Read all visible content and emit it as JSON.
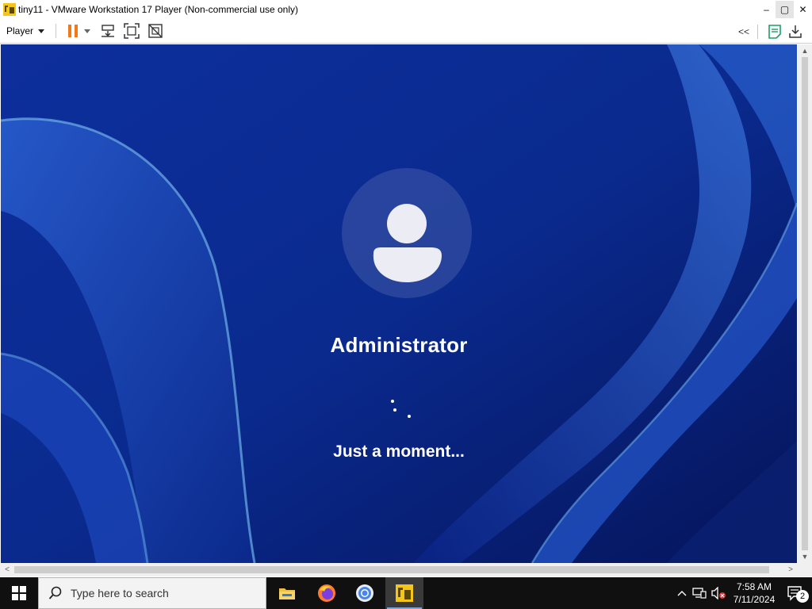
{
  "window": {
    "title": "tiny11 - VMware Workstation 17 Player (Non-commercial use only)",
    "controls": {
      "minimize": "–",
      "maximize": "▢",
      "close": "✕"
    }
  },
  "toolbar": {
    "player_menu_label": "Player",
    "buttons": [
      "pause-icon",
      "send-ctrl-alt-del-icon",
      "full-screen-icon",
      "unity-icon"
    ],
    "right_buttons": [
      "collapse-toolbar-icon",
      "notes-icon",
      "download-icon"
    ],
    "collapse_label": "<<"
  },
  "guest": {
    "username": "Administrator",
    "status": "Just a moment...",
    "colors": {
      "background": "#0b2a8f",
      "text": "#ffffff"
    }
  },
  "scrollbars": {
    "up_arrow": "▲",
    "down_arrow": "▼",
    "left_arrow": "<",
    "right_arrow": ">"
  },
  "taskbar": {
    "search_placeholder": "Type here to search",
    "pinned_apps": [
      "file-explorer-icon",
      "firefox-icon",
      "chrome-icon",
      "vmware-player-icon"
    ],
    "tray": {
      "chevron": "^",
      "time": "7:58 AM",
      "date": "7/11/2024",
      "notification_count": "2"
    }
  }
}
